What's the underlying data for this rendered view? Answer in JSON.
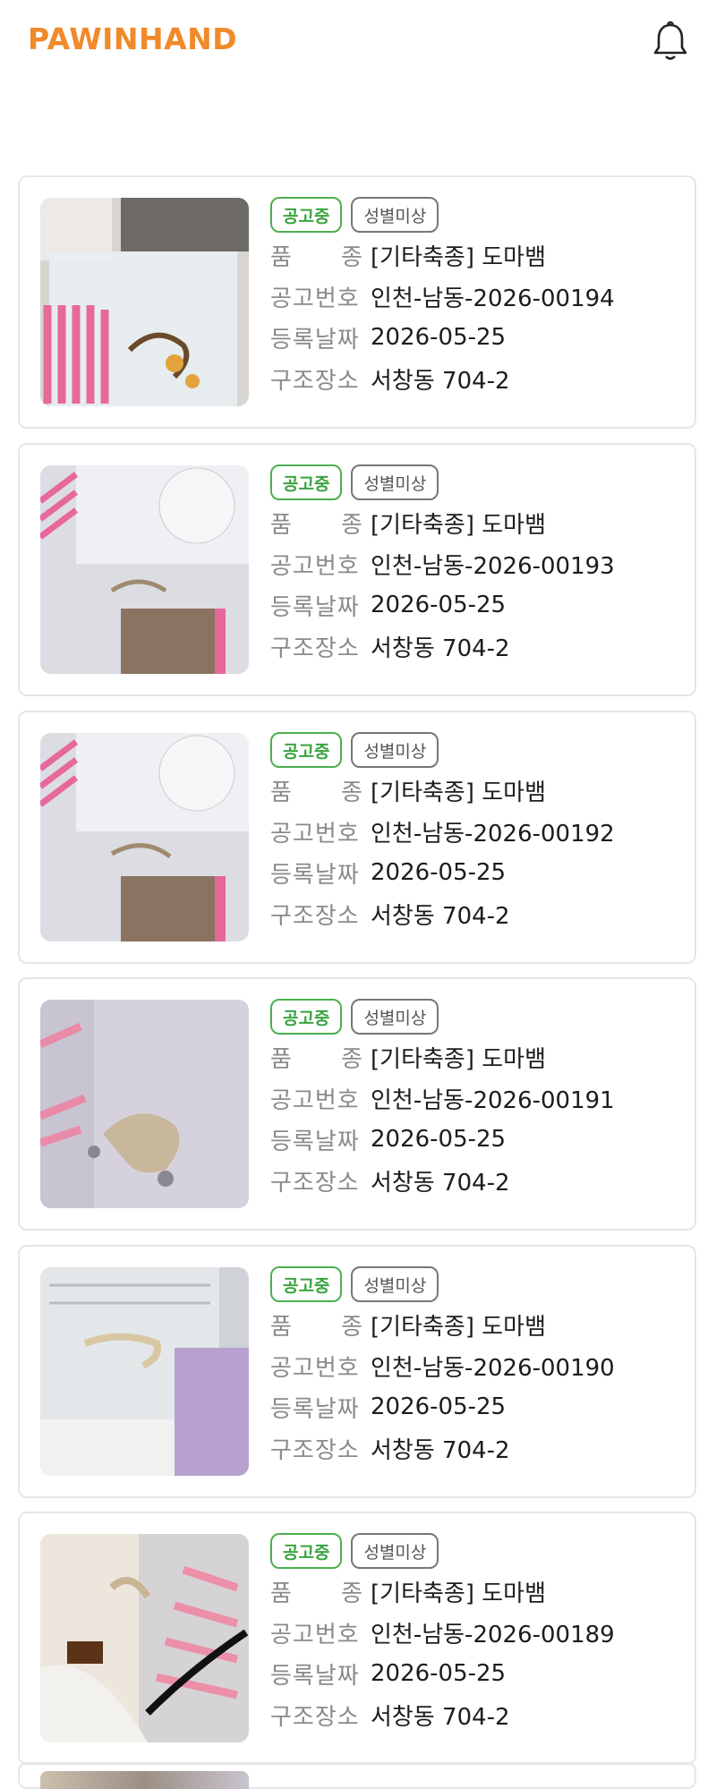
{
  "app": {
    "logo_text": "PAWINHAND",
    "brand_color": "#F08A2A"
  },
  "header": {
    "notification_icon": "bell-icon"
  },
  "labels": {
    "breed_a": "품",
    "breed_b": "종",
    "notice_no": "공고번호",
    "reg_date": "등록날짜",
    "rescue_place": "구조장소"
  },
  "colors": {
    "status_green": "#4CAF50",
    "neutral_border": "#777777"
  },
  "listings": [
    {
      "status": "공고중",
      "sex": "성별미상",
      "breed": "[기타축종] 도마뱀",
      "notice_no": "인천-남동-2026-00194",
      "reg_date": "2026-05-25",
      "rescue_place": "서창동 704-2",
      "photo": "lizard-cage-photo"
    },
    {
      "status": "공고중",
      "sex": "성별미상",
      "breed": "[기타축종] 도마뱀",
      "notice_no": "인천-남동-2026-00193",
      "reg_date": "2026-05-25",
      "rescue_place": "서창동 704-2",
      "photo": "lizard-cage-photo"
    },
    {
      "status": "공고중",
      "sex": "성별미상",
      "breed": "[기타축종] 도마뱀",
      "notice_no": "인천-남동-2026-00192",
      "reg_date": "2026-05-25",
      "rescue_place": "서창동 704-2",
      "photo": "lizard-cage-photo"
    },
    {
      "status": "공고중",
      "sex": "성별미상",
      "breed": "[기타축종] 도마뱀",
      "notice_no": "인천-남동-2026-00191",
      "reg_date": "2026-05-25",
      "rescue_place": "서창동 704-2",
      "photo": "lizard-cage-photo"
    },
    {
      "status": "공고중",
      "sex": "성별미상",
      "breed": "[기타축종] 도마뱀",
      "notice_no": "인천-남동-2026-00190",
      "reg_date": "2026-05-25",
      "rescue_place": "서창동 704-2",
      "photo": "lizard-cage-photo"
    },
    {
      "status": "공고중",
      "sex": "성별미상",
      "breed": "[기타축종] 도마뱀",
      "notice_no": "인천-남동-2026-00189",
      "reg_date": "2026-05-25",
      "rescue_place": "서창동 704-2",
      "photo": "lizard-cage-photo"
    }
  ]
}
